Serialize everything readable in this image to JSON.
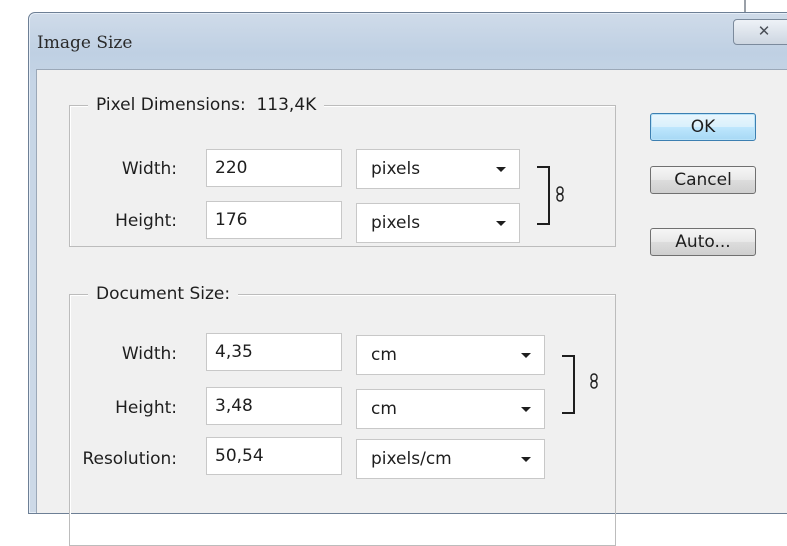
{
  "window": {
    "title": "Image Size",
    "close_glyph": "✕"
  },
  "pixel_dimensions": {
    "label": "Pixel Dimensions:",
    "size": "113,4K",
    "width": {
      "label": "Width:",
      "value": "220",
      "unit": "pixels"
    },
    "height": {
      "label": "Height:",
      "value": "176",
      "unit": "pixels"
    }
  },
  "document_size": {
    "label": "Document Size:",
    "width": {
      "label": "Width:",
      "value": "4,35",
      "unit": "cm"
    },
    "height": {
      "label": "Height:",
      "value": "3,48",
      "unit": "cm"
    },
    "resolution": {
      "label": "Resolution:",
      "value": "50,54",
      "unit": "pixels/cm"
    }
  },
  "buttons": {
    "ok": "OK",
    "cancel": "Cancel",
    "auto": "Auto..."
  },
  "icons": [
    "chain-link-icon",
    "chevron-down-icon",
    "close-icon"
  ]
}
